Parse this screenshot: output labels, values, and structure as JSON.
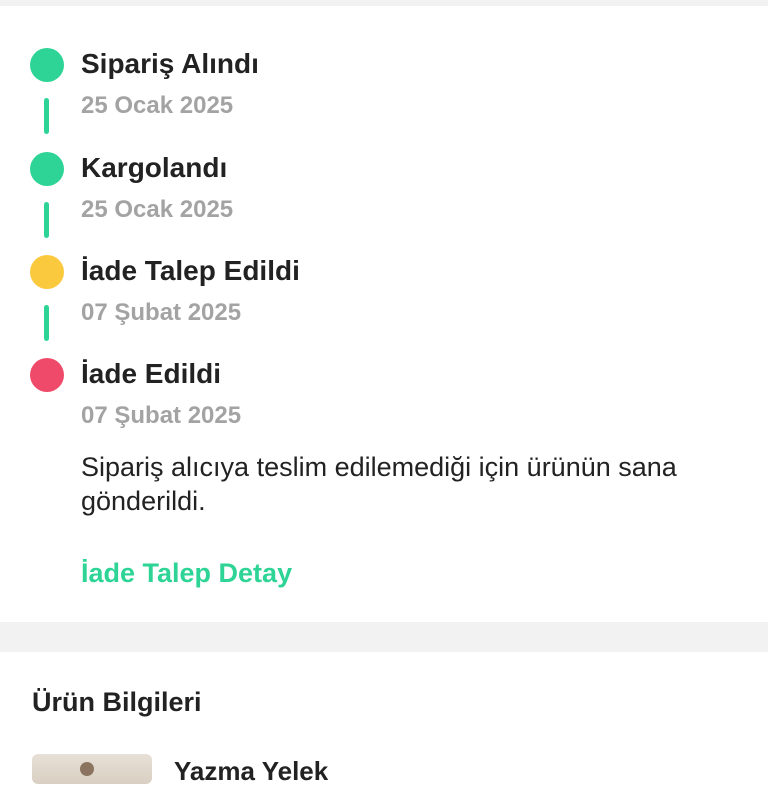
{
  "timeline": {
    "steps": [
      {
        "title": "Sipariş Alındı",
        "date": "25 Ocak 2025",
        "status_color": "#2dd496"
      },
      {
        "title": "Kargolandı",
        "date": "25 Ocak 2025",
        "status_color": "#2dd496"
      },
      {
        "title": "İade Talep Edildi",
        "date": "07 Şubat 2025",
        "status_color": "#fbc93d"
      },
      {
        "title": "İade Edildi",
        "date": "07 Şubat 2025",
        "status_color": "#ef4a69"
      }
    ],
    "connector_color": "#2dd496",
    "final_description": "Sipariş alıcıya teslim edilemediği için ürünün sana gönderildi.",
    "detail_link": "İade Talep Detay",
    "link_color": "#2dd496"
  },
  "product_section": {
    "heading": "Ürün Bilgileri",
    "product_name": "Yazma Yelek"
  }
}
